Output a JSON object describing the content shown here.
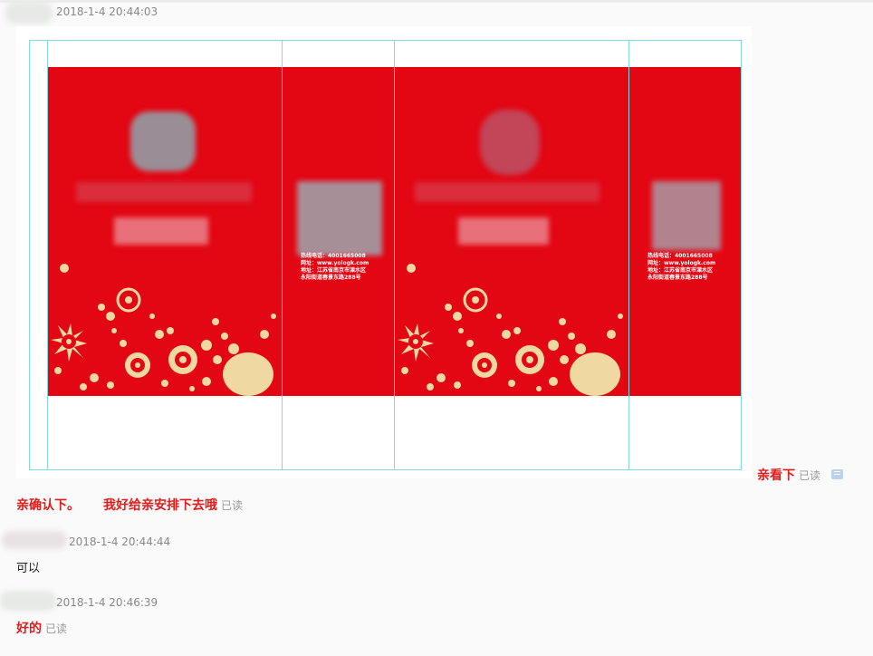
{
  "messages": [
    {
      "timestamp": "2018-1-4 20:44:03"
    },
    {
      "caption": "亲看下",
      "read": "已读"
    },
    {
      "text_a": "亲确认下。",
      "text_b": "我好给亲安排下去哦",
      "read": "已读"
    },
    {
      "timestamp": "2018-1-4 20:44:44",
      "text": "可以"
    },
    {
      "timestamp": "2018-1-4 20:46:39",
      "text": "好的",
      "read": "已读"
    }
  ],
  "design": {
    "contact_left": "热线电话：4001665008\n网址：www.yologk.com\n地址：江苏省南京市溧水区\n永阳街道春景东路288号",
    "contact_right": "热线电话：4001665008\n网址：www.yologk.com\n地址：江苏省南京市溧水区\n永阳街道春景东路288号"
  },
  "colors": {
    "accent_red": "#e21b1b",
    "print_red": "#e30613",
    "guide": "#7fdbe0",
    "flower": "#f0d9a0"
  }
}
